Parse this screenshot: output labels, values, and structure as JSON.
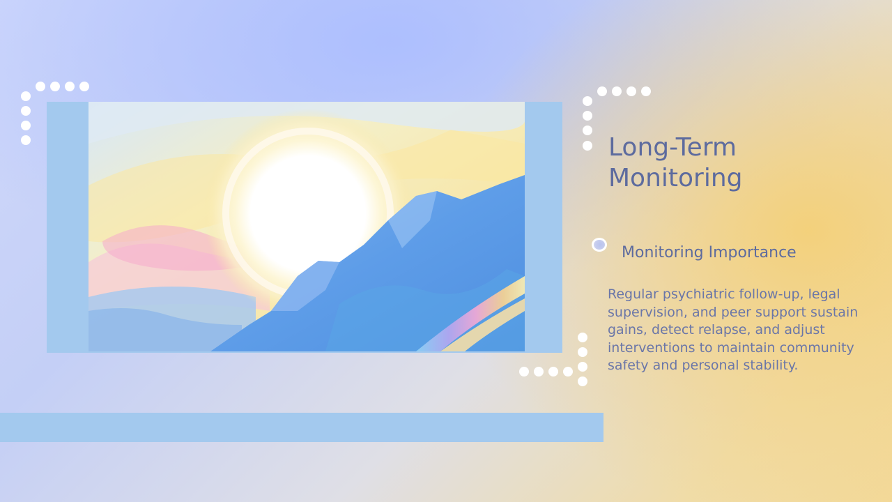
{
  "slide": {
    "title": "Long-Term Monitoring",
    "section": {
      "heading": "Monitoring Importance",
      "body": "Regular psychiatric follow-up, legal supervision, and peer support sustain gains, detect relapse, and adjust interventions to maintain community safety and personal stability."
    }
  },
  "image": {
    "alt": "Pastel painting of a bright sun over blue mountains with a rainbow"
  },
  "colors": {
    "accent_blue": "#a3c9ee",
    "text": "#5d6b9e",
    "dot": "#ffffff",
    "warm_glow": "#f4d078",
    "cool_glow": "#acbeff"
  },
  "icons": {
    "bullet": "ring-bullet-icon",
    "decor": "dot-pattern"
  }
}
